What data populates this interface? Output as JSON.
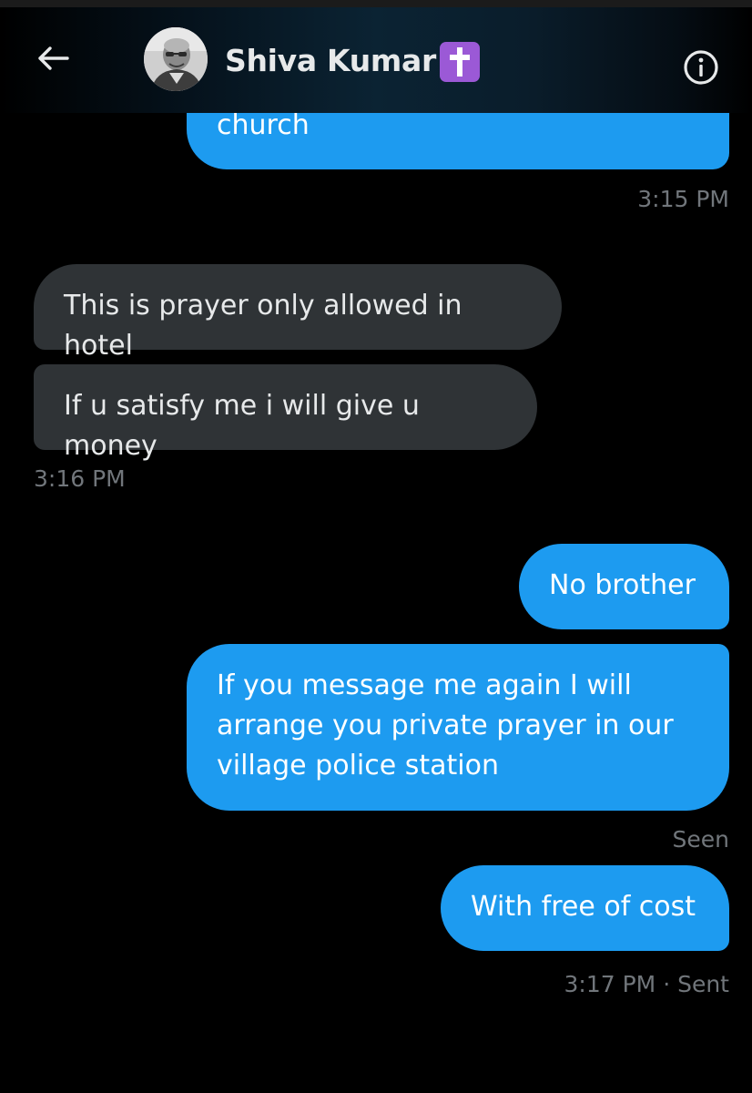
{
  "header": {
    "back_icon": "arrow-left-icon",
    "contact_name": "Shiva Kumar",
    "name_emoji": "latin-cross-emoji",
    "info_icon": "info-circle-icon"
  },
  "colors": {
    "outgoing_bubble": "#1d9bf0",
    "incoming_bubble": "#2f3336",
    "background": "#000000",
    "meta_text": "#71767b",
    "emoji_bg": "#9b59d6"
  },
  "messages": [
    {
      "direction": "outgoing",
      "lines": [
        "church"
      ]
    },
    {
      "direction": "incoming",
      "lines": [
        "This is prayer only allowed in hotel"
      ]
    },
    {
      "direction": "incoming",
      "lines": [
        "If u satisfy me i will give u money"
      ]
    },
    {
      "direction": "outgoing",
      "lines": [
        "No brother"
      ]
    },
    {
      "direction": "outgoing",
      "lines": [
        "If you message me again I will",
        "arrange you private prayer in our",
        "village police station"
      ]
    },
    {
      "direction": "outgoing",
      "lines": [
        "With free of cost"
      ]
    }
  ],
  "meta": {
    "time_1": "3:15 PM",
    "time_2": "3:16 PM",
    "seen": "Seen",
    "time_3": "3:17 PM · Sent"
  }
}
